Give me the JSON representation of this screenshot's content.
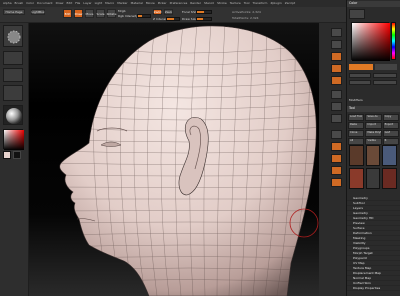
{
  "menu": [
    "Alpha",
    "Brush",
    "Color",
    "Document",
    "Draw",
    "Edit",
    "File",
    "Layer",
    "Light",
    "Macro",
    "Marker",
    "Material",
    "Movie",
    "Picker",
    "Preferences",
    "Render",
    "Stencil",
    "Stroke",
    "Texture",
    "Tool",
    "Transform",
    "Zplugin",
    "Zscript"
  ],
  "topbar": {
    "home_label": "Home Page",
    "lightbox_label": "LightBox",
    "edit_label": "Edit",
    "draw_label": "Draw",
    "move_label": "Move",
    "scale_label": "Scale",
    "rotate_label": "Rotate",
    "mrgb_label": "Mrgb",
    "rgb_label": "Rgb",
    "m_label": "M",
    "zadd_label": "Zadd",
    "zsub_label": "Zsub",
    "rgb_intensity_label": "Rgb Intensity",
    "z_intensity_label": "Z Intensity",
    "focal_shift_label": "Focal Shift",
    "draw_size_label": "Draw Size",
    "active_points": "ActivePoints: 2,324",
    "total_points": "TotalPoints: 2,324",
    "rgb_intensity_level": 0.35,
    "z_intensity_level": 0.55,
    "focal_level": 0.5,
    "draw_size_level": 0.4
  },
  "rightpanel": {
    "color_title": "Color",
    "tool_title": "Tool",
    "modifiers": "Modifiers",
    "tool_buttons": [
      "Load Tool",
      "Save As",
      "Copy",
      "Paste",
      "Import",
      "Export",
      "Clone",
      "Make PolyMesh3D",
      "GoZ",
      "All",
      "Visible",
      "R"
    ],
    "subpalettes": [
      "Geometry",
      "SubTool",
      "Layers",
      "Geometry",
      "Geometry HD",
      "Preview",
      "Surface",
      "Deformation",
      "Masking",
      "Visibility",
      "Polygroups",
      "Morph Target",
      "Polypaint",
      "UV Map",
      "Texture Map",
      "Displacement Map",
      "Normal Map",
      "Unified Skin",
      "Display Properties"
    ],
    "accent": "#d8651e"
  }
}
